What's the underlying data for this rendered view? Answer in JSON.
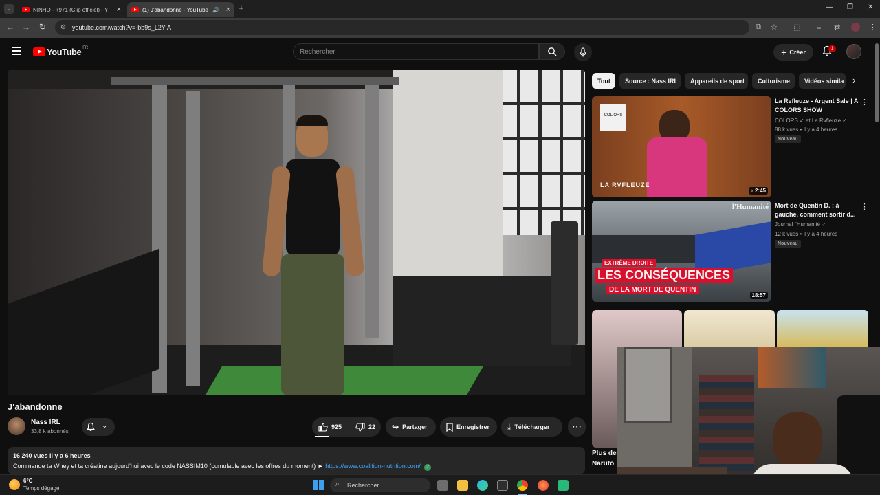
{
  "browser": {
    "tabs": [
      {
        "label": "NINHO - +971 (Clip officiel) - Y"
      },
      {
        "label": "(1) J'abandonne - YouTube"
      }
    ],
    "url": "youtube.com/watch?v=-bb9s_L2Y-A"
  },
  "header": {
    "logo_text": "YouTube",
    "country": "FR",
    "search_placeholder": "Rechercher",
    "create_label": "Créer",
    "notifications_count": "1"
  },
  "video": {
    "title": "J'abandonne",
    "channel": "Nass IRL",
    "subscribers": "33,8 k abonnés",
    "likes": "925",
    "dislikes": "22",
    "share_label": "Partager",
    "save_label": "Enregistrer",
    "download_label": "Télécharger",
    "description": {
      "stats": "16 240 vues  il y a 6 heures",
      "text": "Commande ta Whey et ta créatine aujourd'hui avec le code NASSIM10 (cumulable avec les offres du moment) ► ",
      "link": "https://www.coalition-nutrition.com/"
    }
  },
  "sidebar": {
    "chips": [
      "Tout",
      "Source : Nass IRL",
      "Appareils de sport",
      "Culturisme",
      "Vidéos simila"
    ],
    "videos": [
      {
        "title": "La Rvfleuze - Argent Sale | A COLORS SHOW",
        "channel": "COLORS ✓ et La Rvfleuze ✓",
        "meta": "88 k vues • il y a 4 heures",
        "badge": "Nouveau",
        "duration": "2:45",
        "thumb_text": "LA RVFLEUZE",
        "thumb_logo": "COL ORS"
      },
      {
        "title": "Mort de Quentin D. : à gauche, comment sortir d...",
        "channel": "Journal l'Humanité ✓",
        "meta": "12 k vues • il y a 4 heures",
        "badge": "Nouveau",
        "duration": "18:57",
        "thumb_brand": "l'Humanité",
        "thumb_tag": "EXTRÊME DROITE",
        "thumb_headline": "LES CONSÉQUENCES",
        "thumb_sub": "DE LA MORT DE QUENTIN"
      }
    ],
    "partial_title": "Plus de",
    "partial_title2": "Naruto"
  },
  "taskbar": {
    "weather_temp": "6°C",
    "weather_desc": "Temps dégagé",
    "search_label": "Rechercher"
  },
  "colors": {
    "background": "#0f0f0f",
    "surface": "#272727",
    "accent": "#ff0000",
    "link": "#3ea6ff"
  }
}
